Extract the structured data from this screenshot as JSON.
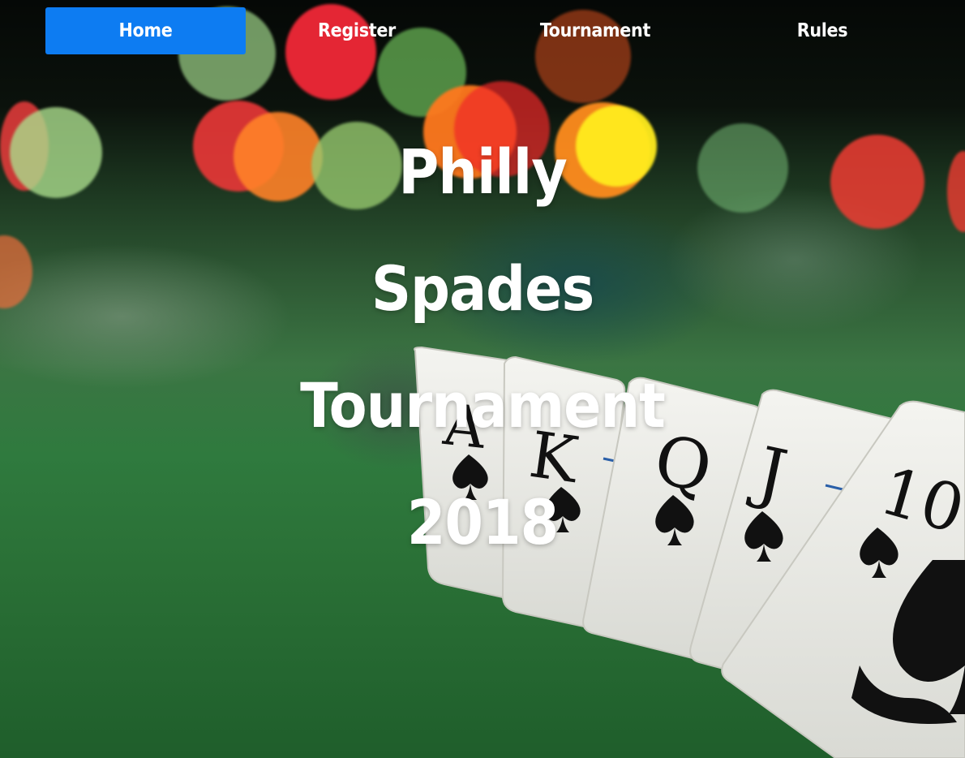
{
  "nav": {
    "items": [
      {
        "label": "Home",
        "active": true
      },
      {
        "label": "Register",
        "active": false
      },
      {
        "label": "Tournament",
        "active": false
      },
      {
        "label": "Rules",
        "active": false
      }
    ],
    "active_color": "#0d7cf2"
  },
  "hero": {
    "lines": [
      "Philly",
      "Spades",
      "Tournament",
      "2018"
    ]
  },
  "background": {
    "description_icon": "poker-cards-royal-flush-image",
    "cards": [
      "A",
      "K",
      "Q",
      "J",
      "10"
    ],
    "felt_color": "#2f7a3e"
  }
}
